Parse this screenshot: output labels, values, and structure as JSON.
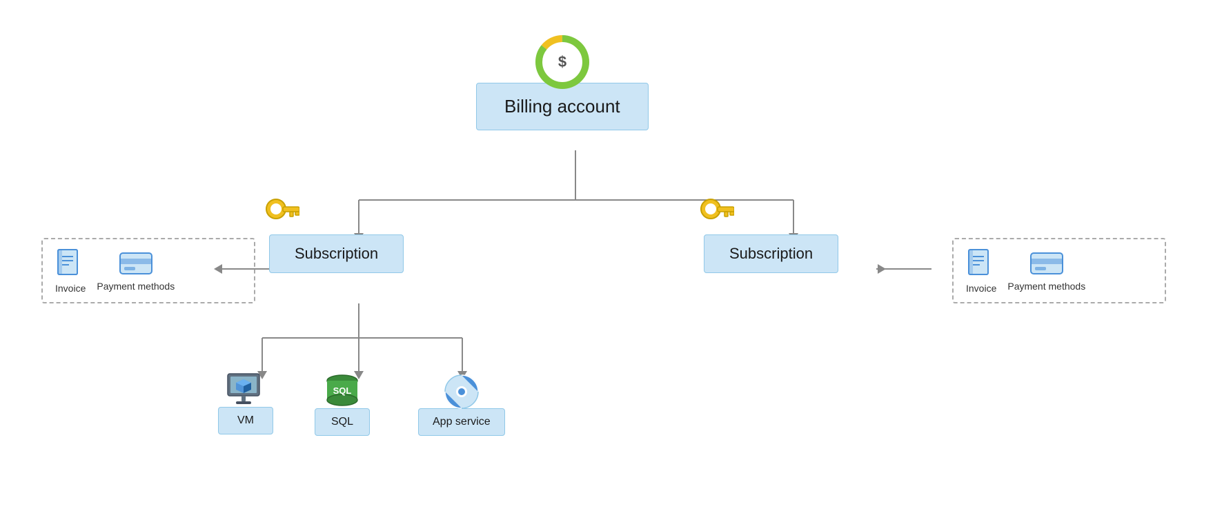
{
  "diagram": {
    "billing_account": {
      "label": "Billing account",
      "icon": "billing-icon"
    },
    "subscription_left": {
      "label": "Subscription"
    },
    "subscription_right": {
      "label": "Subscription"
    },
    "invoice_left": "Invoice",
    "payment_left": "Payment methods",
    "invoice_right": "Invoice",
    "payment_right": "Payment methods",
    "vm": "VM",
    "sql": "SQL",
    "app_service": "App service"
  }
}
